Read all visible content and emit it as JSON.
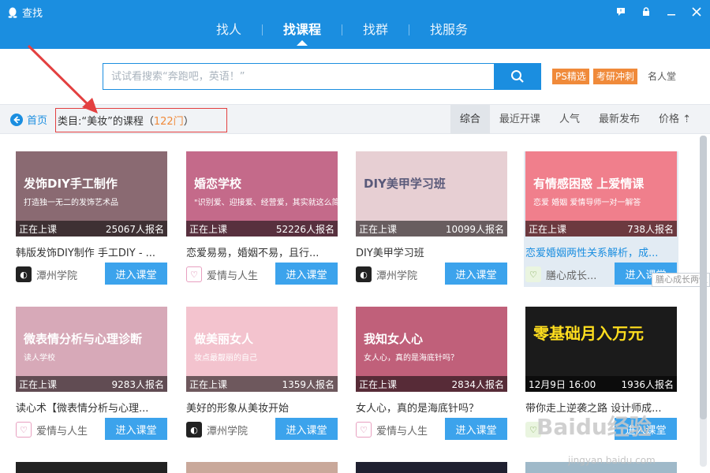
{
  "app": {
    "title": "查找"
  },
  "nav": {
    "tabs": [
      "找人",
      "找课程",
      "找群",
      "找服务"
    ],
    "active": 1
  },
  "search": {
    "placeholder": "试试看搜索“奔跑吧，英语！”"
  },
  "tags": {
    "ps": "PS精选",
    "kaoyan": "考研冲刺",
    "mingren": "名人堂"
  },
  "filter": {
    "home": "首页",
    "category_prefix": "类目:“美妆”的课程（",
    "count": "122门",
    "category_suffix": "）",
    "sort": [
      "综合",
      "最近开课",
      "人气",
      "最新发布",
      "价格 ⇡"
    ],
    "sort_active": 0
  },
  "courses": [
    {
      "status": "正在上课",
      "enrolled": "25067人报名",
      "title": "韩版发饰DIY制作 手工DIY - ...",
      "provider": "潭州学院",
      "button": "进入课堂",
      "thumb_text": "发饰DIY手工制作",
      "thumb_sub": "打造独一无二的发饰艺术品",
      "color": "#8a6a72"
    },
    {
      "status": "正在上课",
      "enrolled": "52226人报名",
      "title": "恋爱易易，婚姻不易，且行...",
      "provider": "爱情与人生",
      "button": "进入课堂",
      "thumb_text": "婚恋学校",
      "thumb_sub": "\"识别爱、迎接爱、经营爱，其实就这么简单",
      "color": "#c46a8a"
    },
    {
      "status": "正在上课",
      "enrolled": "10099人报名",
      "title": "DIY美甲学习班",
      "provider": "潭州学院",
      "button": "进入课堂",
      "thumb_text": "DIY美甲学习班",
      "thumb_sub": "",
      "color": "#e7cfd3"
    },
    {
      "status": "正在上课",
      "enrolled": "738人报名",
      "title": "恋爱婚姻两性关系解析，成...",
      "provider": "膳心成长...",
      "button": "进入课堂",
      "thumb_text": "有情感困惑  上爱情课",
      "thumb_sub": "恋爱  婚姻  爱情导师一对一解答",
      "color": "#f07f8c"
    },
    {
      "status": "正在上课",
      "enrolled": "9283人报名",
      "title": "读心术【微表情分析与心理...",
      "provider": "爱情与人生",
      "button": "进入课堂",
      "thumb_text": "微表情分析与心理诊断",
      "thumb_sub": "读人学校",
      "color": "#d7a9b8"
    },
    {
      "status": "正在上课",
      "enrolled": "1359人报名",
      "title": "美好的形象从美妆开始",
      "provider": "潭州学院",
      "button": "进入课堂",
      "thumb_text": "做美丽女人",
      "thumb_sub": "妆点最靓丽的自己",
      "color": "#f3c3ce"
    },
    {
      "status": "正在上课",
      "enrolled": "2834人报名",
      "title": "女人心，真的是海底针吗？",
      "provider": "爱情与人生",
      "button": "进入课堂",
      "thumb_text": "我知女人心",
      "thumb_sub": "女人心，真的是海底针吗？",
      "color": "#c0607a"
    },
    {
      "status": "12月9日 16:00",
      "enrolled": "1936人报名",
      "title": "带你走上逆袭之路 设计师成...",
      "provider": "",
      "button": "进入课堂",
      "thumb_text": "零基础月入万元",
      "thumb_sub": "",
      "color": "#1b1b1b"
    }
  ],
  "tooltip": "膳心成长两性",
  "watermark": {
    "main": "Baidu经验",
    "sub": "jingyan.baidu.com"
  },
  "colors": {
    "accent": "#1b8ee0",
    "orange": "#f08a3a",
    "highlight_box": "#e34040"
  }
}
